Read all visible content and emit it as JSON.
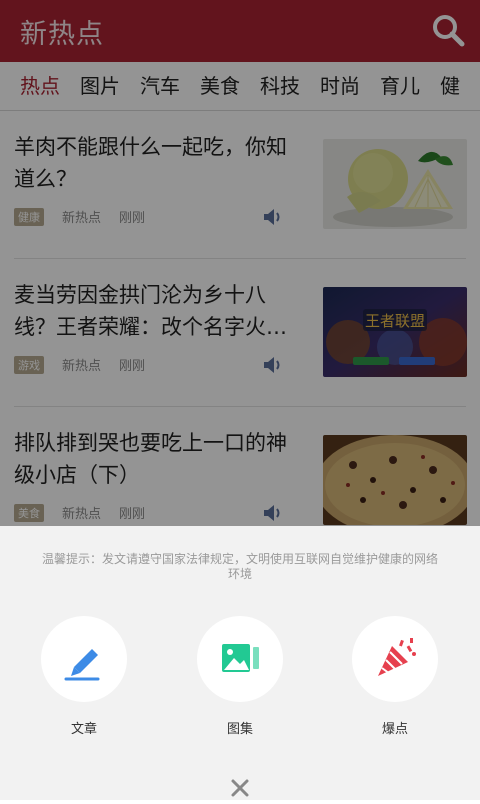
{
  "header": {
    "title": "新热点",
    "icon": "search-icon"
  },
  "tabs": [
    "热点",
    "图片",
    "汽车",
    "美食",
    "科技",
    "时尚",
    "育儿",
    "健"
  ],
  "articles": [
    {
      "title": "羊肉不能跟什么一起吃，你知道么？",
      "tag": "健康",
      "source": "新热点",
      "time": "刚刚",
      "thumb": "grapefruit-image"
    },
    {
      "title": "麦当劳因金拱门沦为乡十八线？王者荣耀：改个名字火…",
      "tag": "游戏",
      "source": "新热点",
      "time": "刚刚",
      "thumb": "game-banner-image",
      "thumb_text": "王者联盟"
    },
    {
      "title": "排队排到哭也要吃上一口的神级小店（下）",
      "tag": "美食",
      "source": "新热点",
      "time": "刚刚",
      "thumb": "pizza-image"
    }
  ],
  "sheet": {
    "notice": "温馨提示：发文请遵守国家法律规定，文明使用互联网自觉维护健康的网络环境",
    "actions": [
      {
        "label": "文章",
        "icon": "pen-icon"
      },
      {
        "label": "图集",
        "icon": "gallery-icon"
      },
      {
        "label": "爆点",
        "icon": "party-popper-icon"
      }
    ],
    "close_icon": "close-icon"
  },
  "colors": {
    "brand": "#a92433",
    "tag_bg": "#b5aa92",
    "gallery_green": "#22c993",
    "pen_blue": "#3d8be6",
    "popper_red": "#e6404e"
  }
}
